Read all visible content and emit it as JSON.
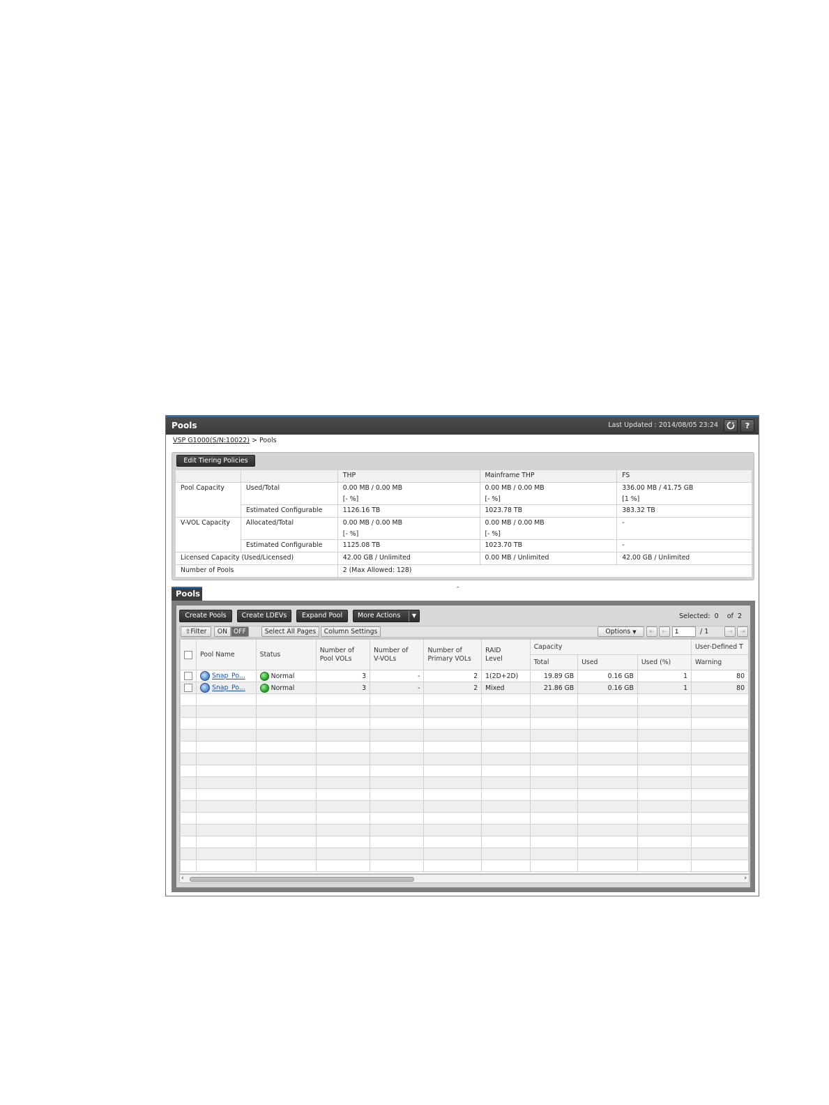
{
  "window": {
    "title": "Pools",
    "last_updated": "Last Updated : 2014/08/05 23:24",
    "refresh_icon": "refresh-icon",
    "help_label": "?"
  },
  "breadcrumb": {
    "root": "VSP G1000(S/N:10022)",
    "separator": ">",
    "current": "Pools"
  },
  "summary": {
    "edit_button": "Edit Tiering Policies",
    "headers": [
      "",
      "",
      "THP",
      "Mainframe THP",
      "FS"
    ],
    "pool_capacity": "Pool Capacity",
    "used_total": "Used/Total",
    "pc_used": [
      "0.00 MB / 0.00 MB",
      "0.00 MB / 0.00 MB",
      "336.00 MB / 41.75 GB"
    ],
    "pc_pct": [
      "[- %]",
      "[- %]",
      "[1 %]"
    ],
    "est_conf": "Estimated Configurable",
    "pc_est": [
      "1126.16 TB",
      "1023.78 TB",
      "383.32 TB"
    ],
    "vvol_capacity": "V-VOL Capacity",
    "allocated_total": "Allocated/Total",
    "vv_alloc": [
      "0.00 MB / 0.00 MB",
      "0.00 MB / 0.00 MB",
      "-"
    ],
    "vv_pct": [
      "[- %]",
      "[- %]"
    ],
    "vv_est": [
      "1125.08 TB",
      "1023.70 TB",
      "-"
    ],
    "licensed": "Licensed Capacity (Used/Licensed)",
    "lic_vals": [
      "42.00 GB / Unlimited",
      "0.00 MB / Unlimited",
      "42.00 GB / Unlimited"
    ],
    "num_pools": "Number of Pools",
    "num_pools_val": "2 (Max Allowed: 128)"
  },
  "pools_tab": "Pools",
  "toolbar": {
    "create_pools": "Create Pools",
    "create_ldevs": "Create LDEVs",
    "expand_pool": "Expand Pool",
    "more_actions": "More Actions",
    "selected_label": "Selected:",
    "selected_count": "0",
    "of_label": "of",
    "total_count": "2"
  },
  "filter": {
    "filter_label": "Filter",
    "on": "ON",
    "off": "OFF",
    "select_all": "Select All Pages",
    "column_settings": "Column Settings",
    "options": "Options",
    "page": "1",
    "page_total": "/ 1"
  },
  "columns": {
    "pool_name": "Pool Name",
    "status": "Status",
    "pool_vols": [
      "Number of",
      "Pool VOLs"
    ],
    "vvols": [
      "Number of",
      "V-VOLs"
    ],
    "primary_vols": [
      "Number of",
      "Primary VOLs"
    ],
    "raid": [
      "RAID",
      "Level"
    ],
    "capacity": "Capacity",
    "total": "Total",
    "used": "Used",
    "used_pct": "Used (%)",
    "user_defined": "User-Defined T",
    "warning": "Warning"
  },
  "rows": [
    {
      "name": "Snap_Po...",
      "status": "Normal",
      "pool_vols": "3",
      "vvols": "-",
      "primary_vols": "2",
      "raid": "1(2D+2D)",
      "total": "19.89 GB",
      "used": "0.16 GB",
      "used_pct": "1",
      "warning": "80"
    },
    {
      "name": "Snap_Po...",
      "status": "Normal",
      "pool_vols": "3",
      "vvols": "-",
      "primary_vols": "2",
      "raid": "Mixed",
      "total": "21.86 GB",
      "used": "0.16 GB",
      "used_pct": "1",
      "warning": "80"
    }
  ]
}
